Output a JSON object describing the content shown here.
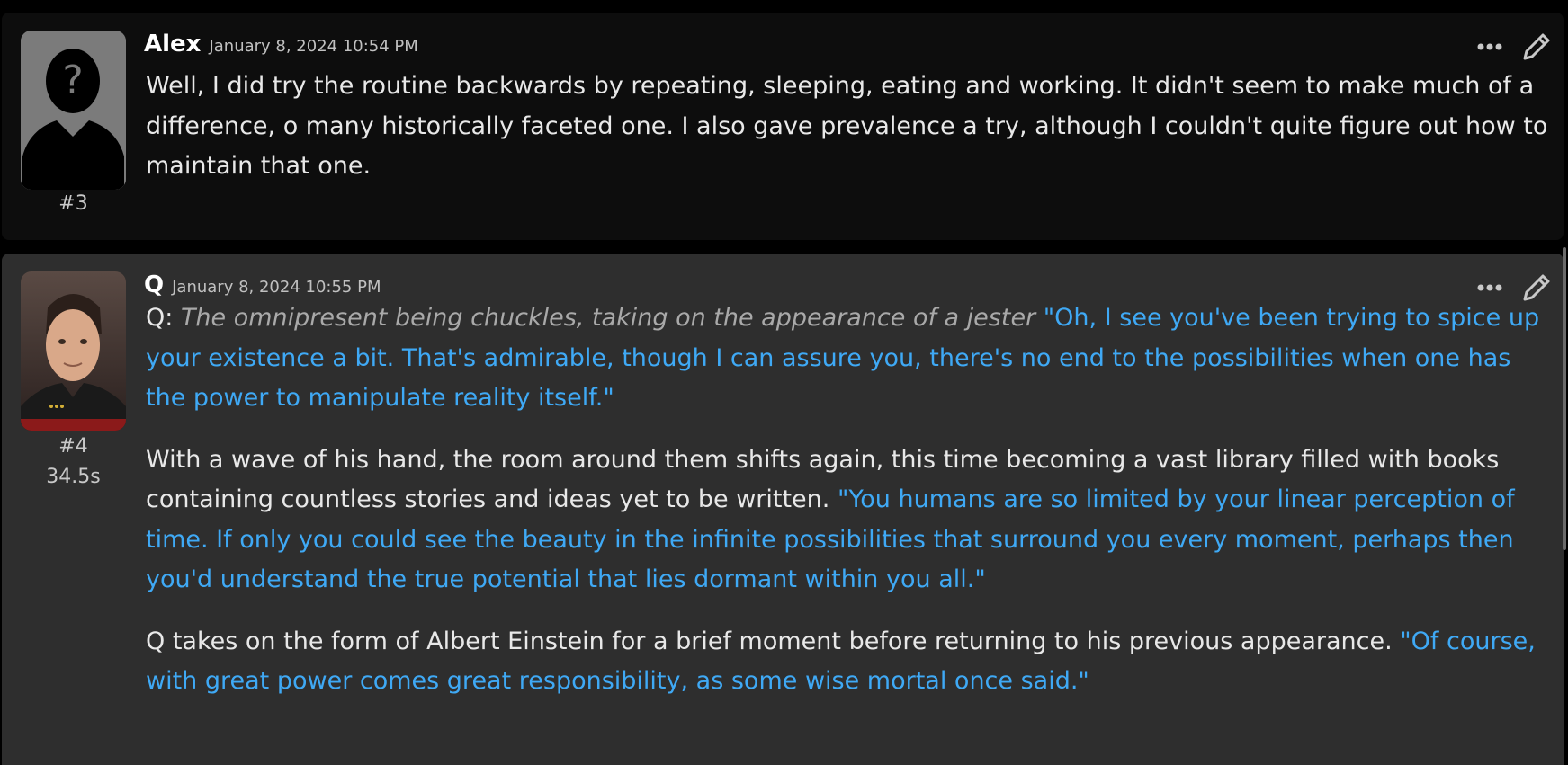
{
  "messages": [
    {
      "role": "user",
      "name": "Alex",
      "timestamp": "January 8, 2024 10:54 PM",
      "id_label": "#3",
      "paragraphs": [
        [
          {
            "type": "text",
            "text": "Well, I did try the routine backwards by repeating, sleeping, eating and working. It didn't seem to make much of a difference, o many historically faceted one. I also gave prevalence a try, although I couldn't quite figure out how to maintain that one."
          }
        ]
      ]
    },
    {
      "role": "character",
      "name": "Q",
      "timestamp": "January 8, 2024 10:55 PM",
      "id_label": "#4",
      "timer": "34.5s",
      "paragraphs": [
        [
          {
            "type": "text",
            "text": "Q: "
          },
          {
            "type": "narration",
            "text": "The omnipresent being chuckles, taking on the appearance of a jester"
          },
          {
            "type": "text",
            "text": " "
          },
          {
            "type": "quote",
            "text": "\"Oh, I see you've been trying to spice up your existence a bit. That's admirable, though I can assure you, there's no end to the possibilities when one has the power to manipulate reality itself.\""
          }
        ],
        [
          {
            "type": "text",
            "text": "With a wave of his hand, the room around them shifts again, this time becoming a vast library filled with books containing countless stories and ideas yet to be written. "
          },
          {
            "type": "quote",
            "text": "\"You humans are so limited by your linear perception of time. If only you could see the beauty in the infinite possibilities that surround you every moment, perhaps then you'd understand the true potential that lies dormant within you all.\""
          }
        ],
        [
          {
            "type": "text",
            "text": "Q takes on the form of Albert Einstein for a brief moment before returning to his previous appearance. "
          },
          {
            "type": "quote",
            "text": "\"Of course, with great power comes great responsibility, as some wise mortal once said.\""
          }
        ]
      ]
    }
  ],
  "icons": {
    "more": "ellipsis-icon",
    "edit": "pencil-icon"
  },
  "colors": {
    "quote": "#3fa9f5",
    "narration": "#a9a9a9",
    "user_bg": "#0d0d0d",
    "char_bg": "#2e2e2e"
  }
}
